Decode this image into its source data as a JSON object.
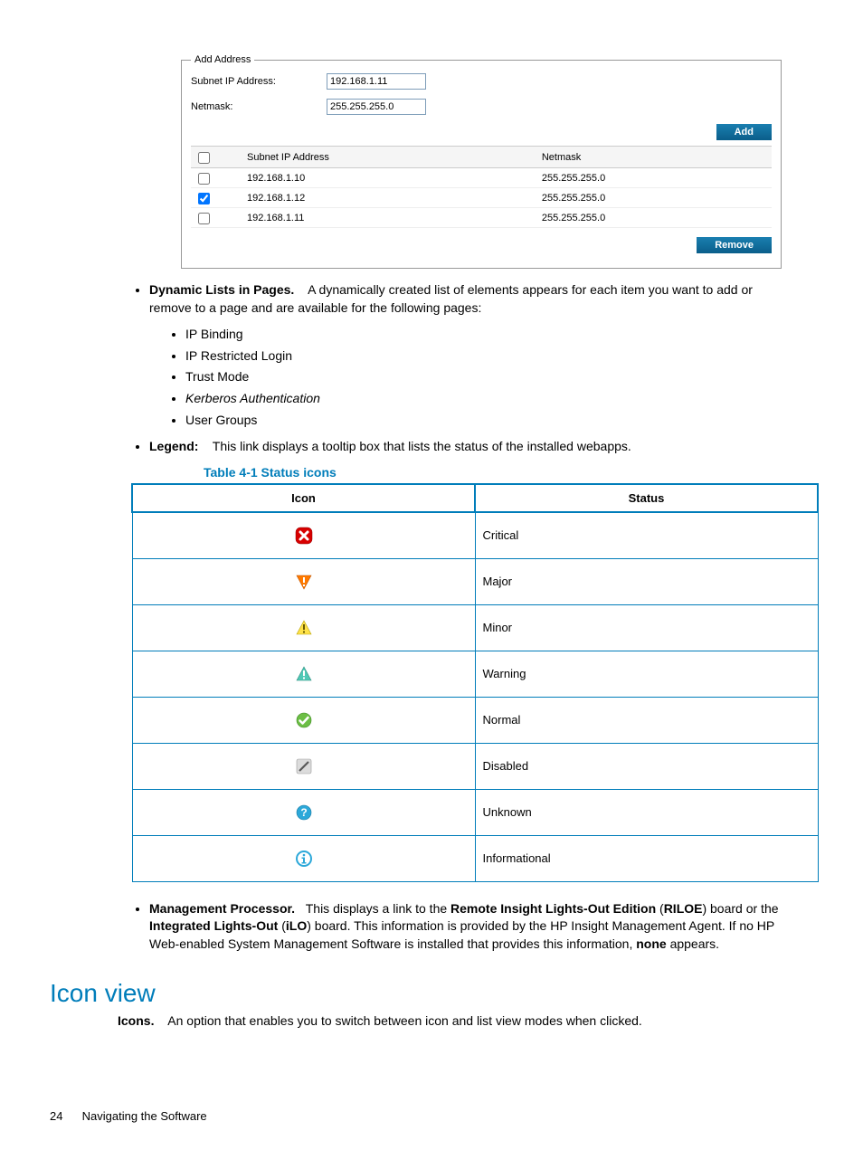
{
  "addAddress": {
    "legend": "Add Address",
    "subnetLabel": "Subnet IP Address:",
    "subnetValue": "192.168.1.11",
    "netmaskLabel": "Netmask:",
    "netmaskValue": "255.255.255.0",
    "addButton": "Add",
    "removeButton": "Remove",
    "tableHeaders": {
      "ip": "Subnet IP Address",
      "mask": "Netmask"
    },
    "rows": [
      {
        "checked": false,
        "ip": "192.168.1.10",
        "mask": "255.255.255.0"
      },
      {
        "checked": true,
        "ip": "192.168.1.12",
        "mask": "255.255.255.0"
      },
      {
        "checked": false,
        "ip": "192.168.1.11",
        "mask": "255.255.255.0"
      }
    ]
  },
  "bullets": {
    "dynamicListsLabel": "Dynamic Lists in Pages.",
    "dynamicListsText": "A dynamically created list of elements appears for each item you want to add or remove to a page and are available for the following pages:",
    "innerItems": [
      "IP Binding",
      "IP Restricted Login",
      "Trust Mode",
      "Kerberos Authentication",
      "User Groups"
    ],
    "legendLabel": "Legend:",
    "legendText": "This link displays a tooltip box that lists the status of the installed webapps.",
    "mgmtLabel": "Management Processor.",
    "mgmtText1": "This displays a link to the ",
    "mgmtBold1": "Remote Insight Lights-Out Edition",
    "mgmtText2": " (",
    "mgmtBold2": "RILOE",
    "mgmtText3": ") board or the ",
    "mgmtBold3": "Integrated Lights-Out",
    "mgmtText4": " (",
    "mgmtBold4": "iLO",
    "mgmtText5": ") board. This information is provided by the HP Insight Management Agent. If no HP Web-enabled System Management Software is installed that provides this information, ",
    "mgmtBold5": "none",
    "mgmtText6": " appears."
  },
  "statusTable": {
    "caption": "Table 4-1 Status icons",
    "headers": {
      "icon": "Icon",
      "status": "Status"
    },
    "rows": [
      {
        "icon": "critical-icon",
        "status": "Critical"
      },
      {
        "icon": "major-icon",
        "status": "Major"
      },
      {
        "icon": "minor-icon",
        "status": "Minor"
      },
      {
        "icon": "warning-icon",
        "status": "Warning"
      },
      {
        "icon": "normal-icon",
        "status": "Normal"
      },
      {
        "icon": "disabled-icon",
        "status": "Disabled"
      },
      {
        "icon": "unknown-icon",
        "status": "Unknown"
      },
      {
        "icon": "info-icon",
        "status": "Informational"
      }
    ]
  },
  "iconView": {
    "heading": "Icon view",
    "iconsLabel": "Icons.",
    "iconsText": "An option that enables you to switch between icon and list view modes when clicked."
  },
  "footer": {
    "page": "24",
    "chapter": "Navigating the Software"
  }
}
